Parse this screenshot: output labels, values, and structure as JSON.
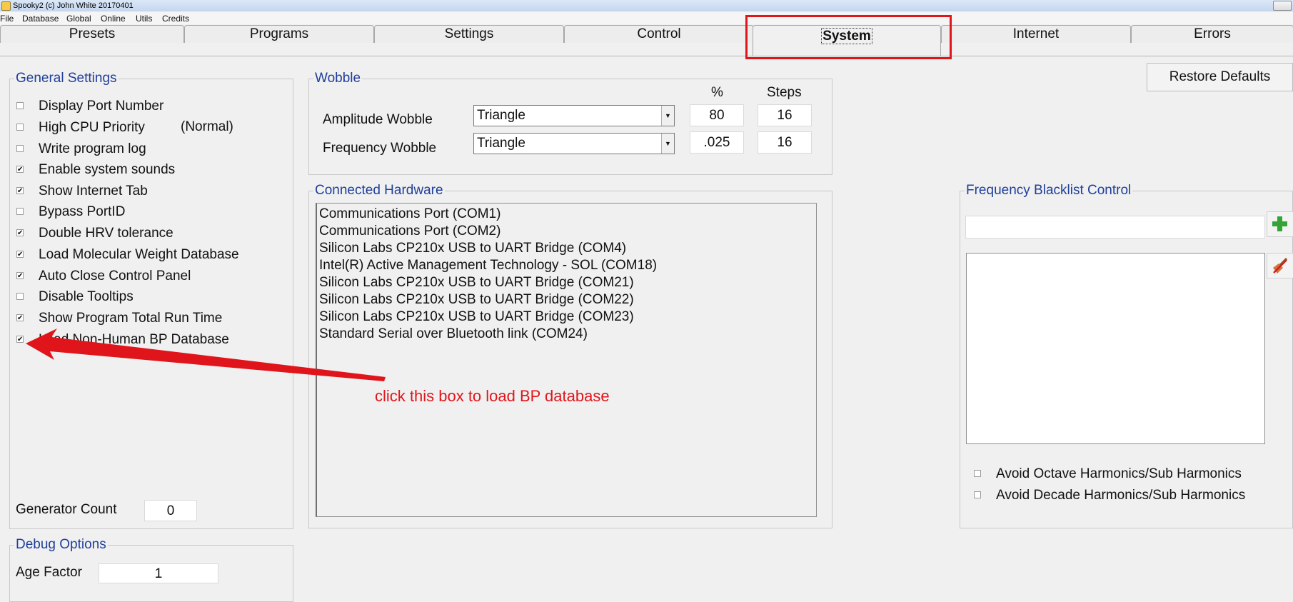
{
  "window": {
    "title": "Spooky2 (c) John White 20170401"
  },
  "menu": [
    "File",
    "Database",
    "Global",
    "Online",
    "Utils",
    "Credits"
  ],
  "tabs": [
    "Presets",
    "Programs",
    "Settings",
    "Control",
    "System",
    "Internet",
    "Errors"
  ],
  "active_tab": "System",
  "restore_defaults_label": "Restore Defaults",
  "general_settings": {
    "title": "General Settings",
    "items": [
      {
        "label": "Display Port Number",
        "checked": false
      },
      {
        "label": "High CPU Priority",
        "checked": false
      },
      {
        "label": "Write program log",
        "checked": false
      },
      {
        "label": "Enable system sounds",
        "checked": true
      },
      {
        "label": "Show Internet Tab",
        "checked": true
      },
      {
        "label": "Bypass PortID",
        "checked": false
      },
      {
        "label": "Double HRV tolerance",
        "checked": true
      },
      {
        "label": "Load Molecular Weight Database",
        "checked": true
      },
      {
        "label": "Auto Close Control Panel",
        "checked": true
      },
      {
        "label": "Disable Tooltips",
        "checked": false
      },
      {
        "label": "Show Program Total Run Time",
        "checked": true
      },
      {
        "label": "Load Non-Human BP Database",
        "checked": true
      }
    ],
    "cpu_priority_note": "(Normal)",
    "generator_count_label": "Generator Count",
    "generator_count_value": "0"
  },
  "debug_options": {
    "title": "Debug Options",
    "age_factor_label": "Age Factor",
    "age_factor_value": "1"
  },
  "wobble": {
    "title": "Wobble",
    "percent_header": "%",
    "steps_header": "Steps",
    "amplitude": {
      "label": "Amplitude Wobble",
      "shape": "Triangle",
      "percent": "80",
      "steps": "16"
    },
    "frequency": {
      "label": "Frequency Wobble",
      "shape": "Triangle",
      "percent": ".025",
      "steps": "16"
    }
  },
  "connected_hardware": {
    "title": "Connected Hardware",
    "items": [
      "Communications Port (COM1)",
      "Communications Port (COM2)",
      "Silicon Labs CP210x USB to UART Bridge (COM4)",
      "Intel(R) Active Management Technology - SOL (COM18)",
      "Silicon Labs CP210x USB to UART Bridge (COM21)",
      "Silicon Labs CP210x USB to UART Bridge (COM22)",
      "Silicon Labs CP210x USB to UART Bridge (COM23)",
      "Standard Serial over Bluetooth link (COM24)"
    ]
  },
  "frequency_blacklist": {
    "title": "Frequency Blacklist Control",
    "input_value": "",
    "avoid_octave_label": "Avoid Octave Harmonics/Sub Harmonics",
    "avoid_octave_checked": false,
    "avoid_decade_label": "Avoid Decade Harmonics/Sub Harmonics",
    "avoid_decade_checked": false
  },
  "annotation": {
    "text": "click this box to load BP database",
    "color": "#e0151b"
  }
}
